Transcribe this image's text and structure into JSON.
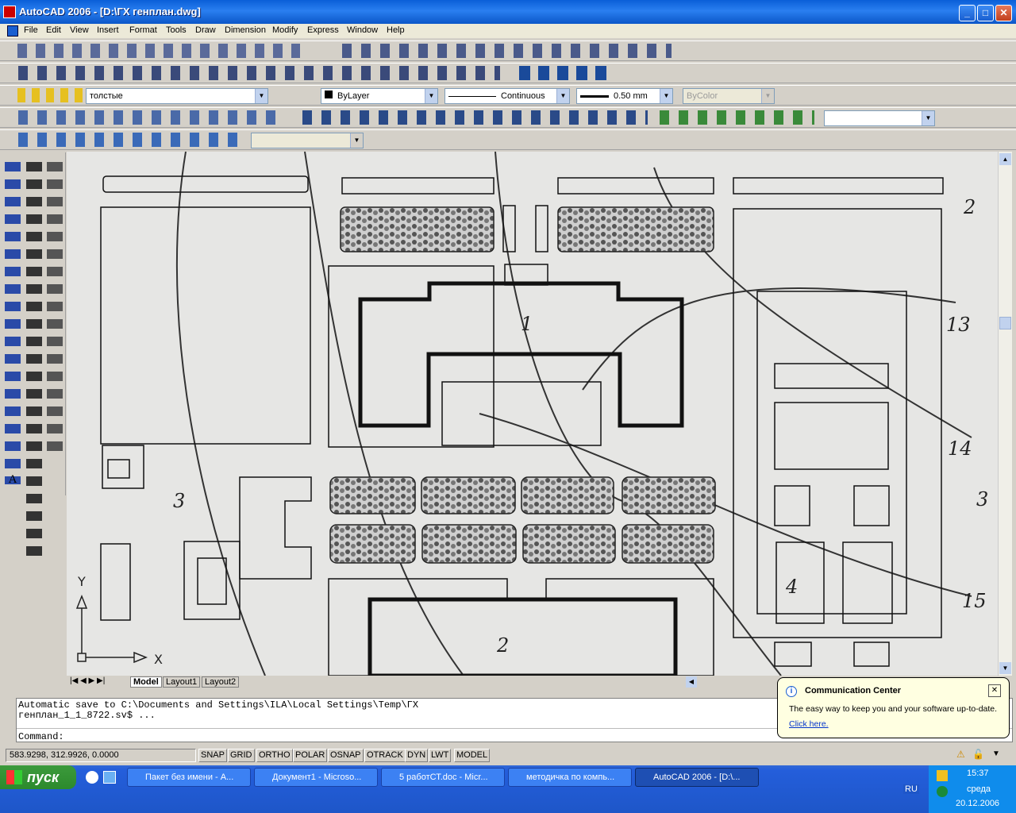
{
  "window": {
    "title": "AutoCAD 2006 - [D:\\ГХ генплан.dwg]",
    "min": "_",
    "max": "□",
    "close": "✕"
  },
  "menu": [
    "File",
    "Edit",
    "View",
    "Insert",
    "Format",
    "Tools",
    "Draw",
    "Dimension",
    "Modify",
    "Express",
    "Window",
    "Help"
  ],
  "layer_combo": "толстые",
  "color_combo": "ByLayer",
  "linetype_combo": "Continuous",
  "lineweight_combo": "0.50 mm",
  "plotstyle_combo": "ByColor",
  "drawing": {
    "labels": [
      "1",
      "2",
      "3",
      "4",
      "13",
      "14",
      "3",
      "15",
      "2"
    ],
    "ucs": {
      "y": "Y",
      "x": "X"
    }
  },
  "tabs": [
    "Model",
    "Layout1",
    "Layout2"
  ],
  "command": {
    "line1": "Automatic save to C:\\Documents and Settings\\ILA\\Local Settings\\Temp\\ГХ",
    "line2": "генплан_1_1_8722.sv$ ...",
    "prompt": "Command:"
  },
  "status": {
    "coords": "583.9298, 312.9926, 0.0000",
    "buttons": [
      "SNAP",
      "GRID",
      "ORTHO",
      "POLAR",
      "OSNAP",
      "OTRACK",
      "DYN",
      "LWT",
      "MODEL"
    ]
  },
  "balloon": {
    "title": "Communication Center",
    "text": "The easy way to keep you and your software up-to-date.",
    "link": "Click here."
  },
  "taskbar": {
    "start": "пуск",
    "tasks": [
      "Пакет без имени - А...",
      "Документ1 - Microso...",
      "5 работСТ.doc - Micr...",
      "методичка по компь...",
      "AutoCAD 2006 - [D:\\..."
    ],
    "lang": "RU",
    "time": "15:37",
    "day": "среда",
    "date": "20.12.2006"
  }
}
